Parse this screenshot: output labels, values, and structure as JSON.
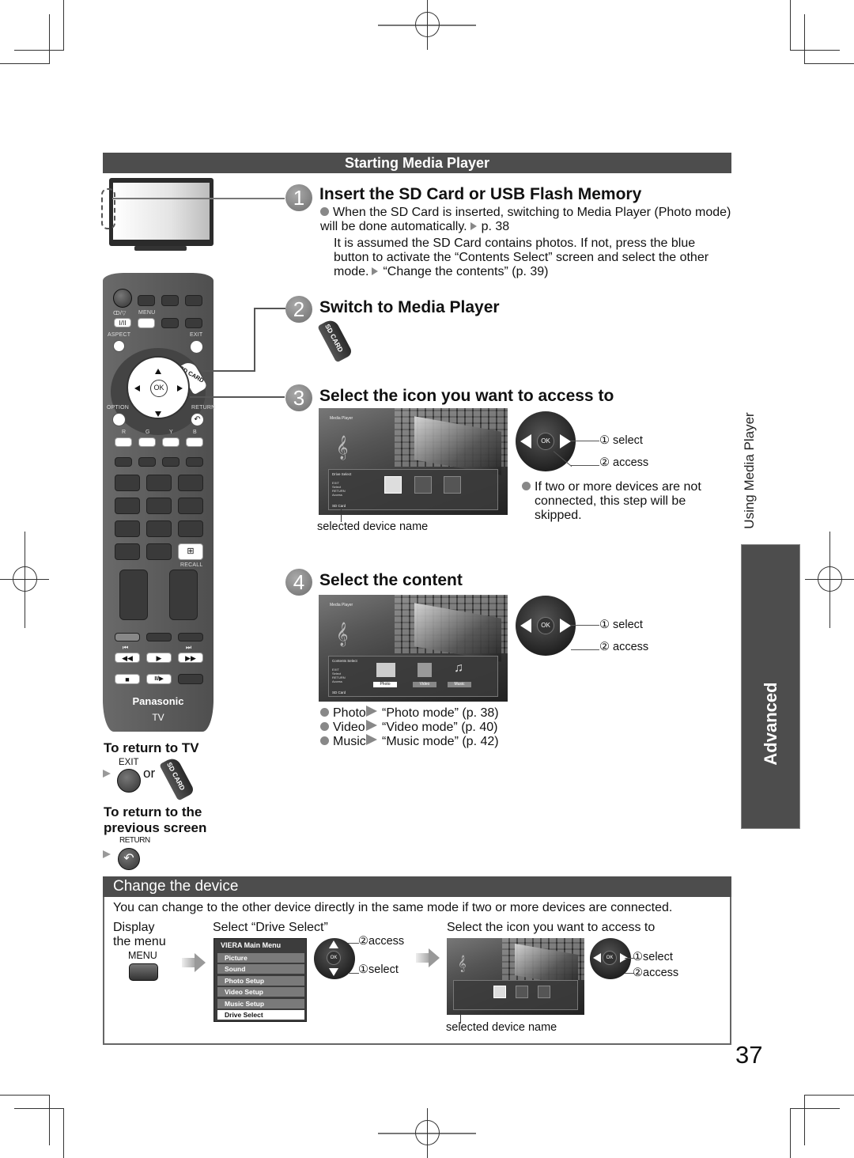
{
  "section_header": "Starting Media Player",
  "steps": [
    {
      "number": "1",
      "title": "Insert the SD Card or USB Flash Memory",
      "bullet_text": "When the SD Card is inserted, switching to Media Player (Photo mode) will be done automatically.",
      "bullet_ref": "p. 38",
      "note": "It is assumed the SD Card contains photos. If not, press the blue button to activate the “Contents Select” screen and select the other mode.",
      "note_ref": "“Change the contents” (p. 39)"
    },
    {
      "number": "2",
      "title": "Switch to Media Player",
      "button_label": "SD CARD"
    },
    {
      "number": "3",
      "title": "Select the icon you want to access to",
      "screen": {
        "title": "Media Player",
        "panel_title": "Drive Select",
        "keys": [
          "EXIT",
          "Select",
          "RETURN"
        ],
        "access_label": "Access",
        "device_name": "SD Card"
      },
      "caption_device": "selected device name",
      "nav_select": "① select",
      "nav_access": "② access",
      "ok_label": "OK",
      "bullet_text": "If two or more devices are not connected, this step will be skipped."
    },
    {
      "number": "4",
      "title": "Select the content",
      "screen": {
        "title": "Media Player",
        "panel_title": "Contents Select",
        "keys": [
          "EXIT",
          "Select",
          "RETURN"
        ],
        "access_label": "Access",
        "device_name": "SD Card",
        "tabs": [
          "Photo",
          "Video",
          "Music"
        ]
      },
      "nav_select": "① select",
      "nav_access": "② access",
      "ok_label": "OK",
      "modes": [
        {
          "label": "Photo",
          "ref": "“Photo mode” (p. 38)"
        },
        {
          "label": "Video",
          "ref": "“Video mode” (p. 40)"
        },
        {
          "label": "Music",
          "ref": "“Music mode” (p. 42)"
        }
      ]
    }
  ],
  "remote": {
    "labels": {
      "input": "ↀ/▽",
      "tv_av": "I/II",
      "menu": "MENU",
      "aspect": "ASPECT",
      "exit": "EXIT",
      "sd_card": "SD CARD",
      "ok": "OK",
      "option": "OPTION",
      "return": "RETURN",
      "r": "R",
      "g": "G",
      "y": "Y",
      "b": "B",
      "recall": "RECALL",
      "brand": "Panasonic",
      "model": "TV"
    }
  },
  "return_tv": {
    "heading": "To return to TV",
    "exit_label": "EXIT",
    "or": "or",
    "sd_card": "SD CARD"
  },
  "return_prev": {
    "heading_line1": "To return to the",
    "heading_line2": "previous screen",
    "return_label": "RETURN"
  },
  "side": {
    "chapter": "Using Media Player",
    "tab": "Advanced"
  },
  "change_device": {
    "header": "Change the device",
    "intro": "You can change to the other device directly in the same mode if two or more devices are connected.",
    "step1_line1": "Display",
    "step1_line2": "the menu",
    "menu_button_label": "MENU",
    "step2": "Select “Drive Select”",
    "menu": {
      "title": "VIERA Main Menu",
      "items": [
        "Picture",
        "Sound",
        "Photo Setup",
        "Video Setup",
        "Music Setup",
        "Drive Select"
      ],
      "selected": "Drive Select"
    },
    "nav1_access": "②access",
    "nav1_select": "①select",
    "step3": "Select the icon you want to access to",
    "nav2_select": "①select",
    "nav2_access": "②access",
    "caption_device": "selected device name",
    "ok_label": "OK"
  },
  "page_number": "37"
}
